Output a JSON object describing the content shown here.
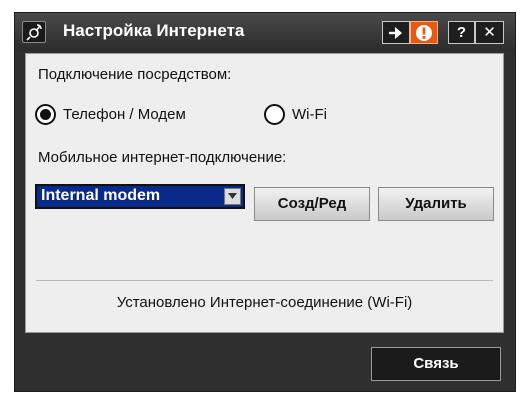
{
  "window": {
    "title": "Настройка Интернета",
    "titlebar_buttons": {
      "help": "?",
      "close": "✕"
    }
  },
  "icons": {
    "app": "satellite-icon",
    "arrow": "arrow-right-icon",
    "warning": "warning-icon",
    "dropdown": "chevron-down-icon"
  },
  "connection": {
    "label": "Подключение посредством:",
    "options": [
      {
        "label": "Телефон / Модем",
        "selected": true
      },
      {
        "label": "Wi-Fi",
        "selected": false
      }
    ]
  },
  "mobile": {
    "label": "Мобильное интернет-подключение:",
    "selected_value": "Internal modem",
    "create_edit_label": "Созд/Ред",
    "delete_label": "Удалить"
  },
  "status": {
    "text": "Установлено Интернет-соединение (Wi-Fi)"
  },
  "footer": {
    "connect_label": "Связь"
  },
  "colors": {
    "accent_warning": "#e85a10",
    "selection": "#0a2a8a",
    "frame": "#2f2f2f"
  }
}
